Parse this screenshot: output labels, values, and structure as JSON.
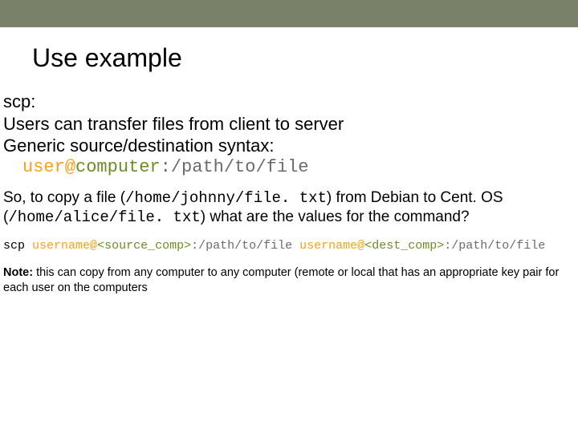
{
  "title": "Use example",
  "intro": {
    "line1": "scp:",
    "line2": "Users can transfer files from client to server",
    "line3": "Generic source/destination syntax:"
  },
  "syntax": {
    "user": "user",
    "at": "@",
    "computer": "computer",
    "colon": ":",
    "path": "/path/to/file"
  },
  "question": {
    "part1": "So, to copy a file (",
    "file1": "/home/johnny/file. txt",
    "part2": ") from Debian to Cent. OS (",
    "file2": "/home/alice/file. txt",
    "part3": ") what are the values for the command?"
  },
  "command": {
    "scp": "scp",
    "src_user": "username",
    "at": "@",
    "src_comp": "<source_comp>",
    "colon": ":",
    "src_path": "/path/to/file",
    "dst_user": "username",
    "dst_comp": "<dest_comp>",
    "dst_path": "/path/to/file"
  },
  "note": {
    "label": "Note:",
    "text": " this can copy from any computer to any computer (remote or local that has an appropriate key pair for each user on the computers"
  }
}
